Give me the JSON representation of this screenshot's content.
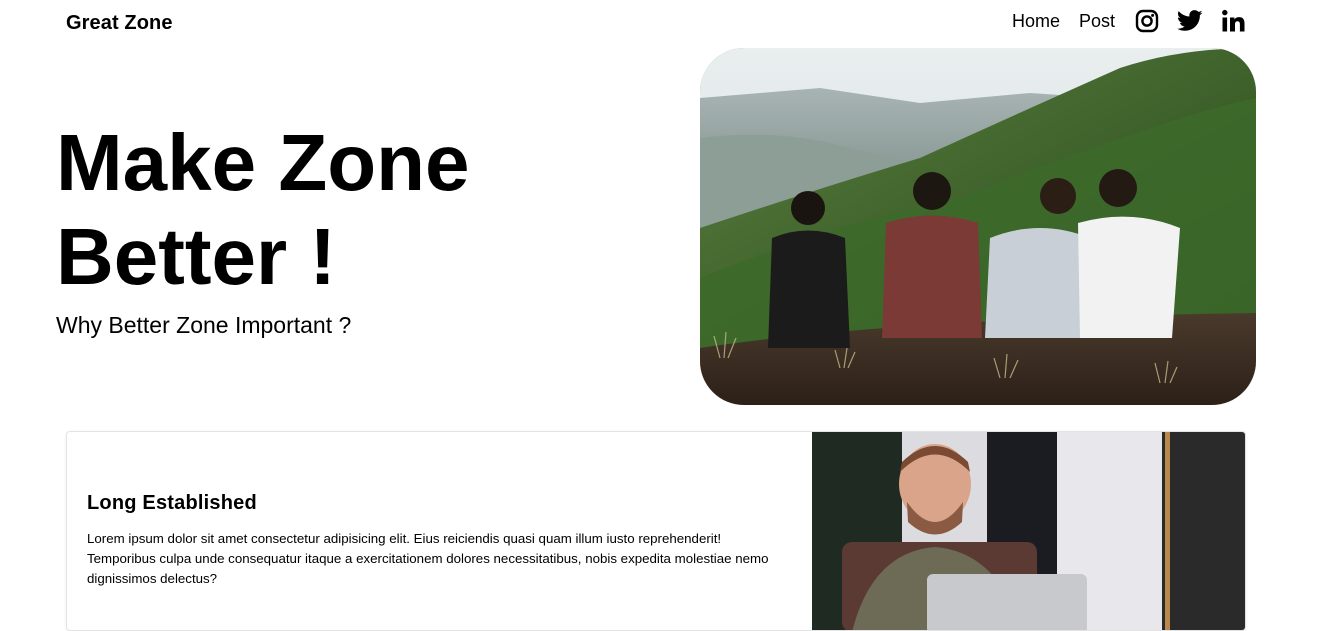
{
  "nav": {
    "brand": "Great Zone",
    "links": [
      "Home",
      "Post"
    ],
    "icons": [
      "instagram-icon",
      "twitter-icon",
      "linkedin-icon"
    ]
  },
  "hero": {
    "title": "Make Zone Better !",
    "subtitle": "Why Better Zone Important ?",
    "image_desc": "four friends sitting on a green mountain ridge"
  },
  "card": {
    "title": "Long Established",
    "text": "Lorem ipsum dolor sit amet consectetur adipisicing elit. Eius reiciendis quasi quam illum iusto reprehenderit! Temporibus culpa unde consequatur itaque a exercitationem dolores necessitatibus, nobis expedita molestiae nemo dignissimos delectus?",
    "image_desc": "smiling man working on a laptop"
  }
}
